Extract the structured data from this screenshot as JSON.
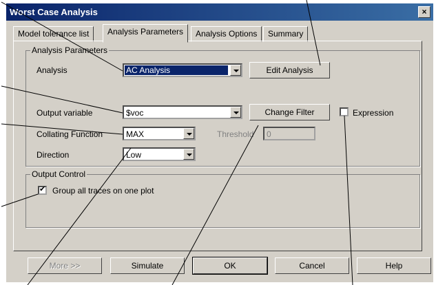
{
  "window": {
    "title": "Worst Case Analysis",
    "close_glyph": "×"
  },
  "tabs": [
    {
      "label": "Model tolerance list"
    },
    {
      "label": "Analysis Parameters"
    },
    {
      "label": "Analysis Options"
    },
    {
      "label": "Summary"
    }
  ],
  "analysis_params": {
    "group_title": "Analysis Parameters",
    "analysis_label": "Analysis",
    "analysis_value": "AC Analysis",
    "edit_analysis_label": "Edit Analysis",
    "output_variable_label": "Output variable",
    "output_variable_value": "$voc",
    "change_filter_label": "Change Filter",
    "expression_label": "Expression",
    "collating_label": "Collating Function",
    "collating_value": "MAX",
    "threshold_label": "Threshold",
    "threshold_value": "0",
    "direction_label": "Direction",
    "direction_value": "Low"
  },
  "output_control": {
    "group_title": "Output Control",
    "group_traces_label": "Group all traces on one plot",
    "group_traces_checked": true,
    "check_glyph": "✔"
  },
  "buttons": {
    "more": "More >>",
    "simulate": "Simulate",
    "ok": "OK",
    "cancel": "Cancel",
    "help": "Help"
  },
  "colors": {
    "title_bar": "#0a246a",
    "dialog_face": "#d4d0c8"
  }
}
